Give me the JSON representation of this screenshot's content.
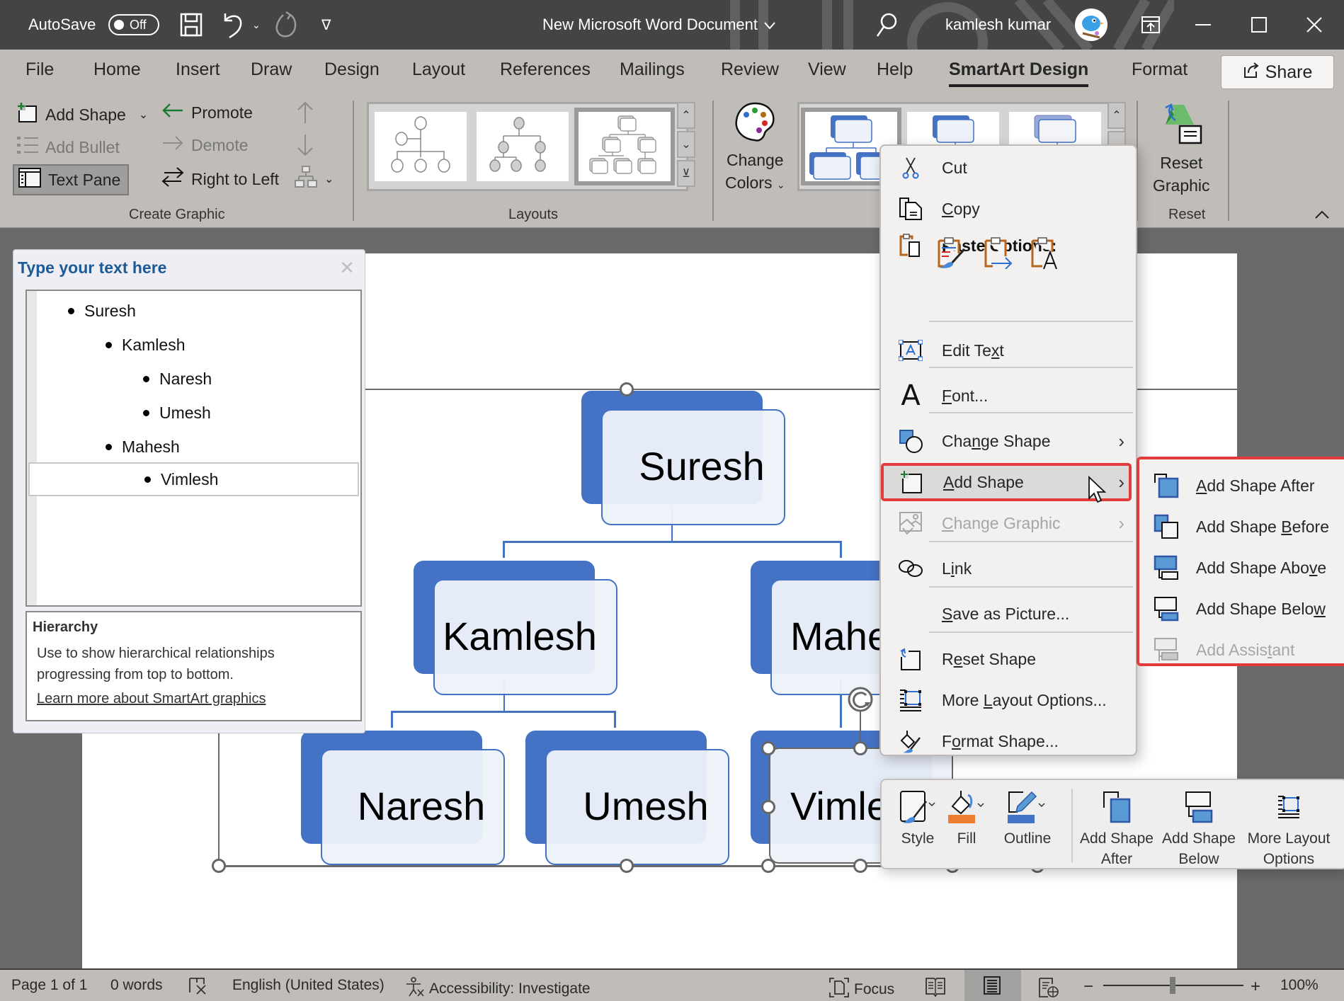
{
  "titlebar": {
    "autosave_label": "AutoSave",
    "autosave_state": "Off",
    "document_title": "New Microsoft Word Document",
    "user_name": "kamlesh kumar",
    "icons": [
      "save-icon",
      "undo-icon",
      "redo-icon",
      "customize-qat-icon",
      "search-icon",
      "ribbon-display-icon",
      "minimize-icon",
      "maximize-icon",
      "close-icon"
    ]
  },
  "tabs": [
    {
      "label": "File"
    },
    {
      "label": "Home"
    },
    {
      "label": "Insert"
    },
    {
      "label": "Draw"
    },
    {
      "label": "Design"
    },
    {
      "label": "Layout"
    },
    {
      "label": "References"
    },
    {
      "label": "Mailings"
    },
    {
      "label": "Review"
    },
    {
      "label": "View"
    },
    {
      "label": "Help"
    },
    {
      "label": "SmartArt Design",
      "active": true
    },
    {
      "label": "Format"
    }
  ],
  "share_label": "Share",
  "ribbon": {
    "create_graphic": {
      "label": "Create Graphic",
      "add_shape": "Add Shape",
      "add_bullet": "Add Bullet",
      "text_pane": "Text Pane",
      "promote": "Promote",
      "demote": "Demote",
      "right_to_left": "Right to Left"
    },
    "layouts": {
      "label": "Layouts"
    },
    "change_colors": {
      "line1": "Change",
      "line2": "Colors"
    },
    "reset": {
      "label": "Reset",
      "reset_graphic_line1": "Reset",
      "reset_graphic_line2": "Graphic"
    }
  },
  "text_pane": {
    "title": "Type your text here",
    "items": [
      {
        "text": "Suresh",
        "level": 1
      },
      {
        "text": "Kamlesh",
        "level": 2
      },
      {
        "text": "Naresh",
        "level": 3
      },
      {
        "text": "Umesh",
        "level": 3
      },
      {
        "text": "Mahesh",
        "level": 2
      },
      {
        "text": "Vimlesh",
        "level": 3,
        "selected": true
      }
    ],
    "info_title": "Hierarchy",
    "info_desc_line1": "Use to show hierarchical relationships",
    "info_desc_line2": "progressing from top to bottom.",
    "info_link": "Learn more about SmartArt graphics"
  },
  "smartart": {
    "nodes": {
      "suresh": "Suresh",
      "kamlesh": "Kamlesh",
      "mahesh": "Mahe",
      "naresh": "Naresh",
      "umesh": "Umesh",
      "vimlesh": "Vimle"
    },
    "accent_color": "#4472c4"
  },
  "context_menu": {
    "cut": "Cut",
    "copy": "Copy",
    "paste_options": "Paste Options:",
    "edit_text": "Edit Text",
    "font": "Font...",
    "change_shape": "Change Shape",
    "add_shape": "Add Shape",
    "change_graphic": "Change Graphic",
    "link": "Link",
    "save_as_picture": "Save as Picture...",
    "reset_shape": "Reset Shape",
    "more_layout_options": "More Layout Options...",
    "format_shape": "Format Shape...",
    "highlight_color": "#e23b3b"
  },
  "submenu": {
    "after": "Add Shape After",
    "before": "Add Shape Before",
    "above": "Add Shape Above",
    "below": "Add Shape Below",
    "assistant": "Add Assistant"
  },
  "mini_toolbar": {
    "style": "Style",
    "fill": "Fill",
    "outline": "Outline",
    "add_after_1": "Add Shape",
    "add_after_2": "After",
    "add_below_1": "Add Shape",
    "add_below_2": "Below",
    "more_layout_1": "More Layout",
    "more_layout_2": "Options",
    "fill_color": "#ed7d31",
    "outline_color": "#4472c4"
  },
  "status": {
    "page": "Page 1 of 1",
    "words": "0 words",
    "language": "English (United States)",
    "accessibility": "Accessibility: Investigate",
    "focus": "Focus",
    "zoom": "100%",
    "zoom_percent": 100
  }
}
